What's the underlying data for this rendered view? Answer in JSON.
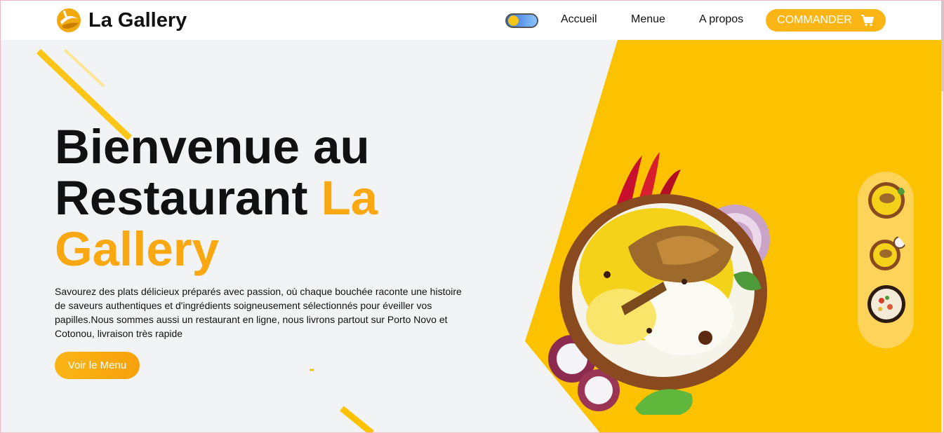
{
  "nav": {
    "brand": "La Gallery",
    "links": [
      "Accueil",
      "Menue",
      "A propos"
    ],
    "order_label": "COMMANDER"
  },
  "hero": {
    "title_part1": "Bienvenue au Restaurant ",
    "title_accent": "La Gallery",
    "description": "Savourez des plats délicieux préparés avec passion, où chaque bouchée raconte une histoire de saveurs authentiques et d'ingrédients soigneusement sélectionnés pour éveiller vos papilles.Nous sommes aussi un restaurant en ligne, nous livrons partout sur Porto Novo et Cotonou, livraison très rapide",
    "cta_label": "Voir le Menu"
  },
  "colors": {
    "accent": "#f9a812",
    "yellow": "#fcc200",
    "background": "#f2f3f5"
  },
  "icons": [
    "logo-icon",
    "theme-toggle",
    "cart-icon",
    "dish-image",
    "thumbnail-dish"
  ]
}
